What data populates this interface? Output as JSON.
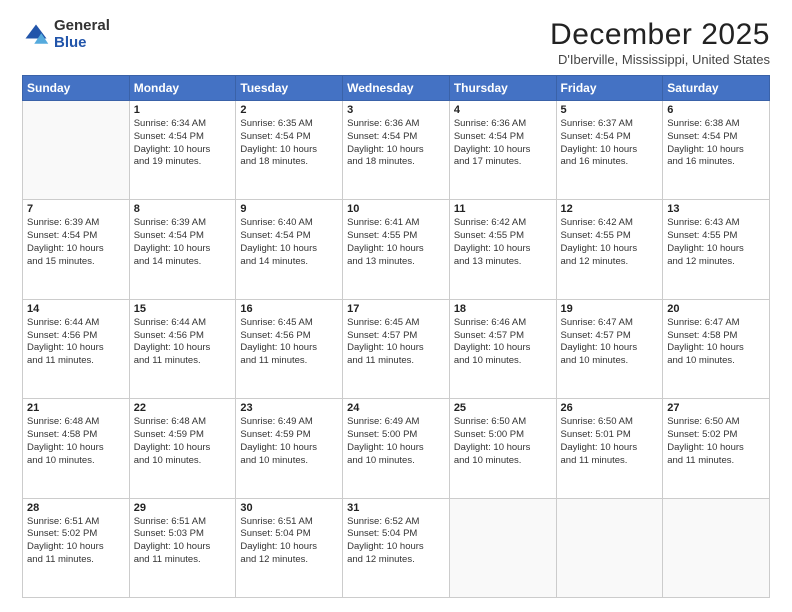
{
  "logo": {
    "general": "General",
    "blue": "Blue"
  },
  "title": "December 2025",
  "subtitle": "D'Iberville, Mississippi, United States",
  "days_of_week": [
    "Sunday",
    "Monday",
    "Tuesday",
    "Wednesday",
    "Thursday",
    "Friday",
    "Saturday"
  ],
  "weeks": [
    [
      {
        "num": "",
        "info": ""
      },
      {
        "num": "1",
        "info": "Sunrise: 6:34 AM\nSunset: 4:54 PM\nDaylight: 10 hours\nand 19 minutes."
      },
      {
        "num": "2",
        "info": "Sunrise: 6:35 AM\nSunset: 4:54 PM\nDaylight: 10 hours\nand 18 minutes."
      },
      {
        "num": "3",
        "info": "Sunrise: 6:36 AM\nSunset: 4:54 PM\nDaylight: 10 hours\nand 18 minutes."
      },
      {
        "num": "4",
        "info": "Sunrise: 6:36 AM\nSunset: 4:54 PM\nDaylight: 10 hours\nand 17 minutes."
      },
      {
        "num": "5",
        "info": "Sunrise: 6:37 AM\nSunset: 4:54 PM\nDaylight: 10 hours\nand 16 minutes."
      },
      {
        "num": "6",
        "info": "Sunrise: 6:38 AM\nSunset: 4:54 PM\nDaylight: 10 hours\nand 16 minutes."
      }
    ],
    [
      {
        "num": "7",
        "info": "Sunrise: 6:39 AM\nSunset: 4:54 PM\nDaylight: 10 hours\nand 15 minutes."
      },
      {
        "num": "8",
        "info": "Sunrise: 6:39 AM\nSunset: 4:54 PM\nDaylight: 10 hours\nand 14 minutes."
      },
      {
        "num": "9",
        "info": "Sunrise: 6:40 AM\nSunset: 4:54 PM\nDaylight: 10 hours\nand 14 minutes."
      },
      {
        "num": "10",
        "info": "Sunrise: 6:41 AM\nSunset: 4:55 PM\nDaylight: 10 hours\nand 13 minutes."
      },
      {
        "num": "11",
        "info": "Sunrise: 6:42 AM\nSunset: 4:55 PM\nDaylight: 10 hours\nand 13 minutes."
      },
      {
        "num": "12",
        "info": "Sunrise: 6:42 AM\nSunset: 4:55 PM\nDaylight: 10 hours\nand 12 minutes."
      },
      {
        "num": "13",
        "info": "Sunrise: 6:43 AM\nSunset: 4:55 PM\nDaylight: 10 hours\nand 12 minutes."
      }
    ],
    [
      {
        "num": "14",
        "info": "Sunrise: 6:44 AM\nSunset: 4:56 PM\nDaylight: 10 hours\nand 11 minutes."
      },
      {
        "num": "15",
        "info": "Sunrise: 6:44 AM\nSunset: 4:56 PM\nDaylight: 10 hours\nand 11 minutes."
      },
      {
        "num": "16",
        "info": "Sunrise: 6:45 AM\nSunset: 4:56 PM\nDaylight: 10 hours\nand 11 minutes."
      },
      {
        "num": "17",
        "info": "Sunrise: 6:45 AM\nSunset: 4:57 PM\nDaylight: 10 hours\nand 11 minutes."
      },
      {
        "num": "18",
        "info": "Sunrise: 6:46 AM\nSunset: 4:57 PM\nDaylight: 10 hours\nand 10 minutes."
      },
      {
        "num": "19",
        "info": "Sunrise: 6:47 AM\nSunset: 4:57 PM\nDaylight: 10 hours\nand 10 minutes."
      },
      {
        "num": "20",
        "info": "Sunrise: 6:47 AM\nSunset: 4:58 PM\nDaylight: 10 hours\nand 10 minutes."
      }
    ],
    [
      {
        "num": "21",
        "info": "Sunrise: 6:48 AM\nSunset: 4:58 PM\nDaylight: 10 hours\nand 10 minutes."
      },
      {
        "num": "22",
        "info": "Sunrise: 6:48 AM\nSunset: 4:59 PM\nDaylight: 10 hours\nand 10 minutes."
      },
      {
        "num": "23",
        "info": "Sunrise: 6:49 AM\nSunset: 4:59 PM\nDaylight: 10 hours\nand 10 minutes."
      },
      {
        "num": "24",
        "info": "Sunrise: 6:49 AM\nSunset: 5:00 PM\nDaylight: 10 hours\nand 10 minutes."
      },
      {
        "num": "25",
        "info": "Sunrise: 6:50 AM\nSunset: 5:00 PM\nDaylight: 10 hours\nand 10 minutes."
      },
      {
        "num": "26",
        "info": "Sunrise: 6:50 AM\nSunset: 5:01 PM\nDaylight: 10 hours\nand 11 minutes."
      },
      {
        "num": "27",
        "info": "Sunrise: 6:50 AM\nSunset: 5:02 PM\nDaylight: 10 hours\nand 11 minutes."
      }
    ],
    [
      {
        "num": "28",
        "info": "Sunrise: 6:51 AM\nSunset: 5:02 PM\nDaylight: 10 hours\nand 11 minutes."
      },
      {
        "num": "29",
        "info": "Sunrise: 6:51 AM\nSunset: 5:03 PM\nDaylight: 10 hours\nand 11 minutes."
      },
      {
        "num": "30",
        "info": "Sunrise: 6:51 AM\nSunset: 5:04 PM\nDaylight: 10 hours\nand 12 minutes."
      },
      {
        "num": "31",
        "info": "Sunrise: 6:52 AM\nSunset: 5:04 PM\nDaylight: 10 hours\nand 12 minutes."
      },
      {
        "num": "",
        "info": ""
      },
      {
        "num": "",
        "info": ""
      },
      {
        "num": "",
        "info": ""
      }
    ]
  ]
}
